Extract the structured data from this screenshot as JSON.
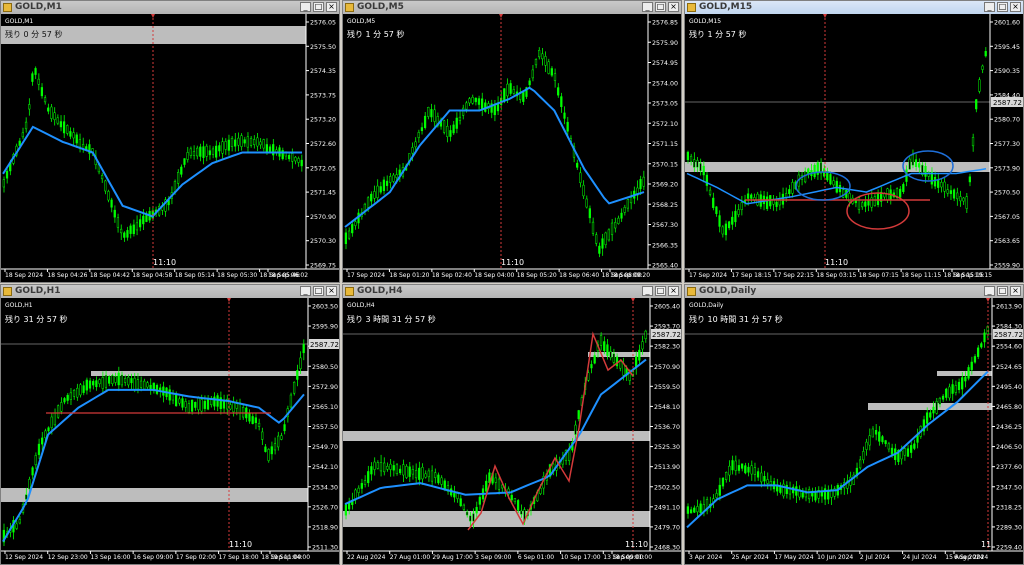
{
  "app": {
    "name": "MetaTrader"
  },
  "colors": {
    "candle": "#00ff00",
    "ma": "#1e90ff",
    "zone": "#c0c0c0",
    "line": "#d33a3a",
    "grid": "#1a1a1a"
  },
  "windows": [
    {
      "id": "m1",
      "title": "GOLD,M1",
      "subtitle": "GOLD,M1",
      "timer": "残り 0 分 57 秒",
      "active": false,
      "price_labels": [
        "2576.05",
        "2575.50",
        "2574.35",
        "2573.75",
        "2573.20",
        "2572.60",
        "2572.05",
        "2571.45",
        "2570.90",
        "2570.30",
        "2569.75"
      ],
      "time_labels": [
        "18 Sep 2024",
        "18 Sep 04:26",
        "18 Sep 04:42",
        "18 Sep 04:58",
        "18 Sep 05:14",
        "18 Sep 05:30",
        "18 Sep 05:46",
        "18 Sep 06:02"
      ],
      "cursor_time": "11:10",
      "current_price": ""
    },
    {
      "id": "m5",
      "title": "GOLD,M5",
      "subtitle": "GOLD,M5",
      "timer": "残り 1 分 57 秒",
      "active": false,
      "price_labels": [
        "2576.85",
        "2575.90",
        "2574.95",
        "2574.00",
        "2573.05",
        "2572.10",
        "2571.15",
        "2570.15",
        "2569.20",
        "2568.25",
        "2567.30",
        "2566.35",
        "2565.40"
      ],
      "time_labels": [
        "17 Sep 2024",
        "18 Sep 01:20",
        "18 Sep 02:40",
        "18 Sep 04:00",
        "18 Sep 05:20",
        "18 Sep 06:40",
        "18 Sep 08:00",
        "18 Sep 09:20"
      ],
      "cursor_time": "11:10",
      "current_price": ""
    },
    {
      "id": "m15",
      "title": "GOLD,M15",
      "subtitle": "GOLD,M15",
      "timer": "残り 1 分 57 秒",
      "active": true,
      "price_labels": [
        "2601.60",
        "2595.45",
        "2590.35",
        "2584.40",
        "2580.70",
        "2577.30",
        "2573.90",
        "2570.50",
        "2567.05",
        "2563.65",
        "2559.90"
      ],
      "time_labels": [
        "17 Sep 2024",
        "17 Sep 18:15",
        "17 Sep 22:15",
        "18 Sep 03:15",
        "18 Sep 07:15",
        "18 Sep 11:15",
        "18 Sep 15:15",
        "18 Sep 19:15"
      ],
      "cursor_time": "11:10",
      "current_price": "2587.72"
    },
    {
      "id": "h1",
      "title": "GOLD,H1",
      "subtitle": "GOLD,H1",
      "timer": "残り 31 分 57 秒",
      "active": false,
      "price_labels": [
        "2603.50",
        "2595.90",
        "2588.30",
        "2580.50",
        "2572.90",
        "2565.10",
        "2557.50",
        "2549.70",
        "2542.10",
        "2534.30",
        "2526.70",
        "2518.90",
        "2511.30"
      ],
      "time_labels": [
        "12 Sep 2024",
        "12 Sep 23:00",
        "13 Sep 16:00",
        "16 Sep 09:00",
        "17 Sep 02:00",
        "17 Sep 18:00",
        "18 Sep 11:00",
        "19 Sep 04:00"
      ],
      "cursor_time": "11:10",
      "current_price": "2587.72"
    },
    {
      "id": "h4",
      "title": "GOLD,H4",
      "subtitle": "GOLD,H4",
      "timer": "残り 3 時間 31 分 57 秒",
      "active": false,
      "price_labels": [
        "2605.40",
        "2593.70",
        "2582.30",
        "2570.90",
        "2559.50",
        "2548.10",
        "2536.70",
        "2525.30",
        "2513.90",
        "2502.50",
        "2491.10",
        "2479.70",
        "2468.30"
      ],
      "time_labels": [
        "22 Aug 2024",
        "27 Aug 01:00",
        "29 Aug 17:00",
        "3 Sep 09:00",
        "6 Sep 01:00",
        "10 Sep 17:00",
        "13 Sep 09:00",
        "18 Sep 01:00"
      ],
      "cursor_time": "11:10",
      "current_price": "2587.72"
    },
    {
      "id": "daily",
      "title": "GOLD,Daily",
      "subtitle": "GOLD,Daily",
      "timer": "残り 10 時間 31 分 57 秒",
      "active": false,
      "price_labels": [
        "2613.90",
        "2584.30",
        "2554.60",
        "2524.65",
        "2495.40",
        "2465.80",
        "2436.25",
        "2406.50",
        "2377.60",
        "2347.50",
        "2318.25",
        "2289.30",
        "2259.40"
      ],
      "time_labels": [
        "3 Apr 2024",
        "25 Apr 2024",
        "17 May 2024",
        "10 Jun 2024",
        "2 Jul 2024",
        "24 Jul 2024",
        "15 Aug 2024",
        "6 Sep 2024"
      ],
      "cursor_time": "11",
      "current_price": "2587.72"
    }
  ]
}
